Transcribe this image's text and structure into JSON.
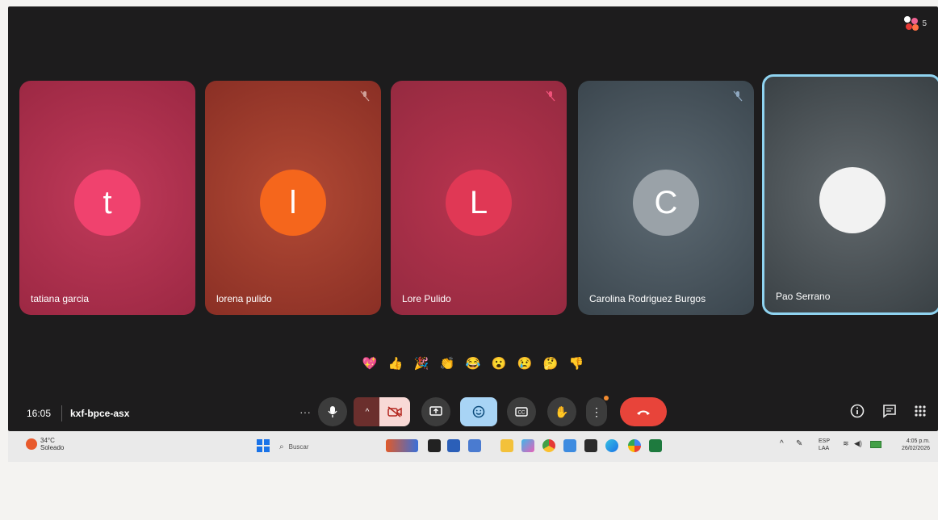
{
  "meeting": {
    "participant_count": "5",
    "time": "16:05",
    "code": "kxf-bpce-asx"
  },
  "participants": [
    {
      "name": "tatiana garcia",
      "initial": "t",
      "muted": false,
      "active": false
    },
    {
      "name": "lorena pulido",
      "initial": "l",
      "muted": true,
      "active": false
    },
    {
      "name": "Lore Pulido",
      "initial": "L",
      "muted": true,
      "active": false
    },
    {
      "name": "Carolina Rodriguez Burgos",
      "initial": "C",
      "muted": true,
      "active": false
    },
    {
      "name": "Pao Serrano",
      "initial": "",
      "muted": false,
      "active": true
    }
  ],
  "reactions": [
    "💖",
    "👍",
    "🎉",
    "👏",
    "😂",
    "😮",
    "😢",
    "🤔",
    "👎"
  ],
  "taskbar": {
    "weather_temp": "34°C",
    "weather_desc": "Soleado",
    "search_placeholder": "Buscar",
    "lang_top": "ESP",
    "lang_bottom": "LAA",
    "clock_time": "4:05 p.m.",
    "clock_date": "26/02/2026"
  },
  "colors": {
    "end_call": "#e8443a",
    "active_outline": "#8fd3f0",
    "emoji_active": "#a8d4f5"
  }
}
